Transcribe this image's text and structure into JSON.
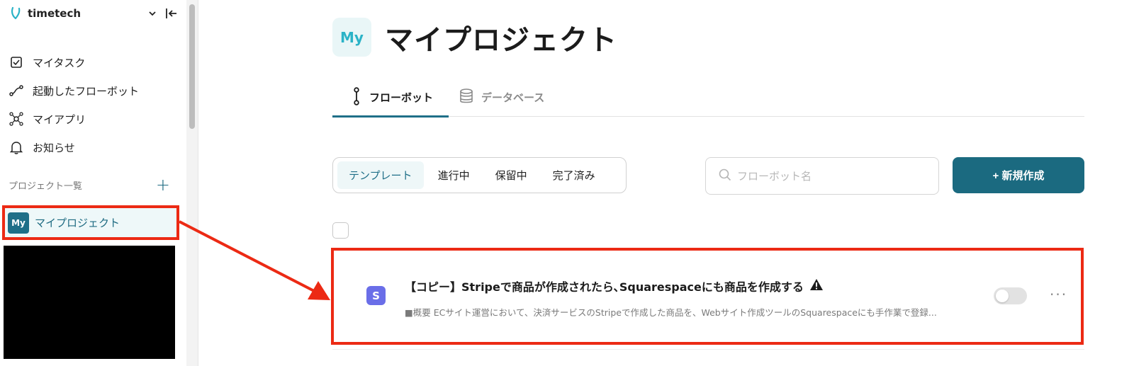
{
  "brand": {
    "name": "timetech"
  },
  "nav": {
    "items": [
      {
        "label": "マイタスク",
        "icon": "checkbox-icon"
      },
      {
        "label": "起動したフローボット",
        "icon": "flow-icon"
      },
      {
        "label": "マイアプリ",
        "icon": "apps-icon"
      },
      {
        "label": "お知らせ",
        "icon": "bell-icon"
      }
    ]
  },
  "projects": {
    "header": "プロジェクト一覧",
    "add_label": "+",
    "items": [
      {
        "avatar": "My",
        "label": "マイプロジェクト"
      }
    ]
  },
  "header": {
    "icon_text": "My",
    "title": "マイプロジェクト"
  },
  "tabs": [
    {
      "label": "フローボット",
      "active": true
    },
    {
      "label": "データベース",
      "active": false
    }
  ],
  "filters": [
    {
      "label": "テンプレート",
      "active": true
    },
    {
      "label": "進行中",
      "active": false
    },
    {
      "label": "保留中",
      "active": false
    },
    {
      "label": "完了済み",
      "active": false
    }
  ],
  "search": {
    "placeholder": "フローボット名",
    "value": ""
  },
  "new_button": {
    "label": "+ 新規作成"
  },
  "flow": {
    "app_icon_letter": "S",
    "title": "【コピー】Stripeで商品が作成されたら､Squarespaceにも商品を作成する",
    "description": "■概要 ECサイト運営において、決済サービスのStripeで作成した商品を、Webサイト作成ツールのSquarespaceにも手作業で登録...",
    "enabled": false,
    "more_label": "···"
  },
  "colors": {
    "accent": "#1f6f88",
    "highlight": "#ec2a14",
    "stripe": "#6a6ee8"
  }
}
